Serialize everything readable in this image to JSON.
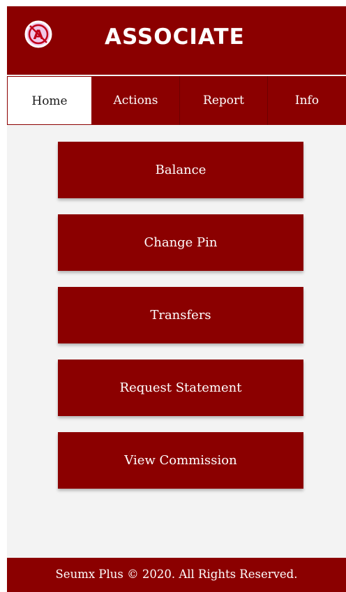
{
  "header": {
    "title": "ASSOCIATE",
    "logo_icon": "associate-logo-icon",
    "logo_letter": "A"
  },
  "tabs": [
    {
      "label": "Home",
      "active": true
    },
    {
      "label": "Actions",
      "active": false
    },
    {
      "label": "Report",
      "active": false
    },
    {
      "label": "Info",
      "active": false
    }
  ],
  "menu": {
    "buttons": [
      {
        "label": "Balance"
      },
      {
        "label": "Change Pin"
      },
      {
        "label": "Transfers"
      },
      {
        "label": "Request Statement"
      },
      {
        "label": "View Commission"
      }
    ]
  },
  "footer": {
    "text": "Seumx Plus © 2020. All Rights Reserved."
  },
  "colors": {
    "brand": "#8b0000",
    "background": "#f3f3f3",
    "text_on_brand": "#ffffff",
    "logo_pink": "#f0c6e8"
  }
}
